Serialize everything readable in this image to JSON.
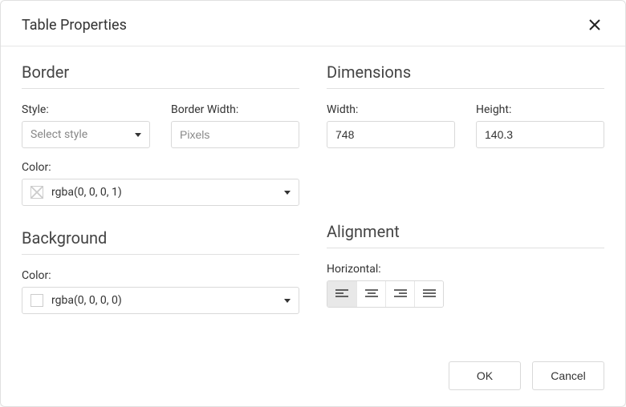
{
  "dialog": {
    "title": "Table Properties"
  },
  "border": {
    "section_title": "Border",
    "style_label": "Style:",
    "style_placeholder": "Select style",
    "width_label": "Border Width:",
    "width_placeholder": "Pixels",
    "width_value": "",
    "color_label": "Color:",
    "color_value": "rgba(0, 0, 0, 1)"
  },
  "dimensions": {
    "section_title": "Dimensions",
    "width_label": "Width:",
    "width_value": "748",
    "height_label": "Height:",
    "height_value": "140.3"
  },
  "background": {
    "section_title": "Background",
    "color_label": "Color:",
    "color_value": "rgba(0, 0, 0, 0)"
  },
  "alignment": {
    "section_title": "Alignment",
    "horizontal_label": "Horizontal:",
    "options": [
      {
        "name": "align-left",
        "active": true
      },
      {
        "name": "align-center",
        "active": false
      },
      {
        "name": "align-right",
        "active": false
      },
      {
        "name": "align-justify",
        "active": false
      }
    ]
  },
  "footer": {
    "ok_label": "OK",
    "cancel_label": "Cancel"
  }
}
